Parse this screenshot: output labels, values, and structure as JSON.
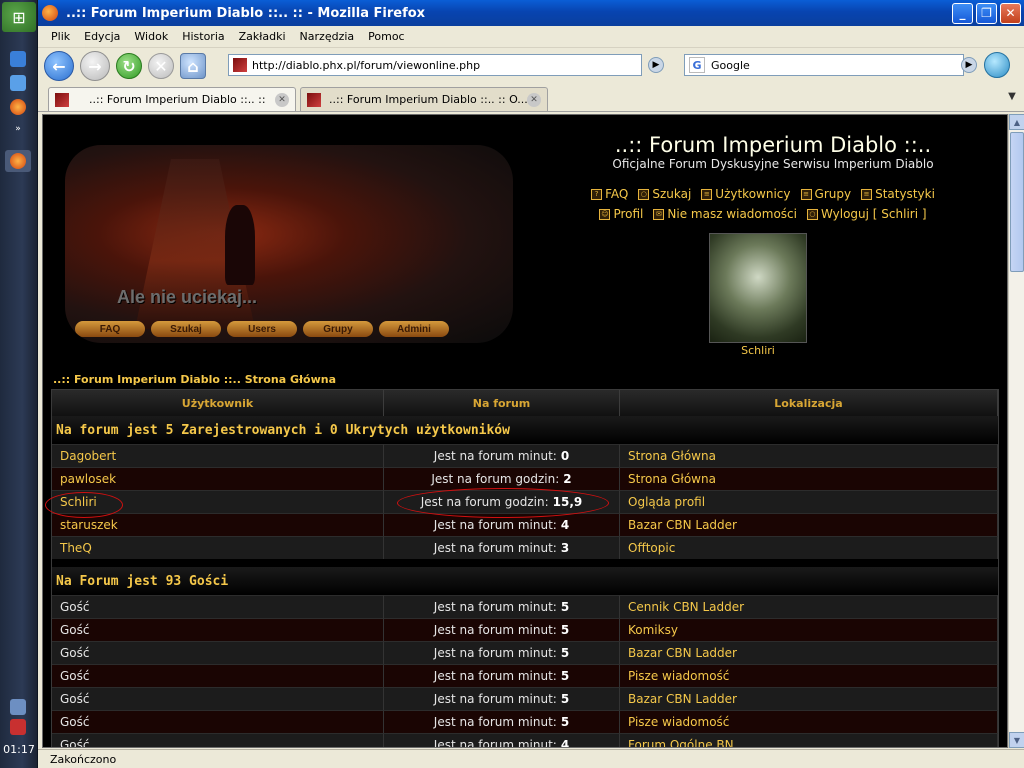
{
  "taskbar": {
    "clock": "01:17"
  },
  "window": {
    "title": "..:: Forum Imperium Diablo ::.. :: - Mozilla Firefox"
  },
  "menu": [
    "Plik",
    "Edycja",
    "Widok",
    "Historia",
    "Zakładki",
    "Narzędzia",
    "Pomoc"
  ],
  "nav": {
    "url": "http://diablo.phx.pl/forum/viewonline.php",
    "search_placeholder": "Google",
    "search_engine_icon": "google-icon"
  },
  "tabs": [
    {
      "label": "..:: Forum Imperium Diablo ::.. ::"
    },
    {
      "label": "..:: Forum Imperium Diablo ::.. :: O..."
    }
  ],
  "header": {
    "title": "..:: Forum Imperium Diablo ::..",
    "subtitle": "Oficjalne Forum Dyskusyjne Serwisu Imperium Diablo",
    "links_row1": [
      "FAQ",
      "Szukaj",
      "Użytkownicy",
      "Grupy",
      "Statystyki"
    ],
    "links_row2": [
      "Profil",
      "Nie masz wiadomości",
      "Wyloguj [ Schliri ]"
    ],
    "avatar_caption": "Schliri"
  },
  "banner": {
    "tagline": "Ale nie uciekaj...",
    "buttons": [
      "FAQ",
      "Szukaj",
      "Users",
      "Grupy",
      "Admini"
    ]
  },
  "breadcrumb": "..:: Forum Imperium Diablo ::.. Strona Główna",
  "table": {
    "headers": [
      "Użytkownik",
      "Na forum",
      "Lokalizacja"
    ],
    "registered_title": "Na forum jest 5 Zarejestrowanych i 0 Ukrytych użytkowników",
    "registered": [
      {
        "user": "Dagobert",
        "time_label": "Jest na forum minut:",
        "time_value": "0",
        "location": "Strona Główna"
      },
      {
        "user": "pawlosek",
        "time_label": "Jest na forum godzin:",
        "time_value": "2",
        "location": "Strona Główna"
      },
      {
        "user": "Schliri",
        "time_label": "Jest na forum godzin:",
        "time_value": "15,9",
        "location": "Ogląda profil"
      },
      {
        "user": "staruszek",
        "time_label": "Jest na forum minut:",
        "time_value": "4",
        "location": "Bazar CBN Ladder"
      },
      {
        "user": "TheQ",
        "time_label": "Jest na forum minut:",
        "time_value": "3",
        "location": "Offtopic"
      }
    ],
    "guests_title": "Na Forum jest 93 Gości",
    "guests": [
      {
        "user": "Gość",
        "time_label": "Jest na forum minut:",
        "time_value": "5",
        "location": "Cennik CBN Ladder"
      },
      {
        "user": "Gość",
        "time_label": "Jest na forum minut:",
        "time_value": "5",
        "location": "Komiksy"
      },
      {
        "user": "Gość",
        "time_label": "Jest na forum minut:",
        "time_value": "5",
        "location": "Bazar CBN Ladder"
      },
      {
        "user": "Gość",
        "time_label": "Jest na forum minut:",
        "time_value": "5",
        "location": "Pisze wiadomość"
      },
      {
        "user": "Gość",
        "time_label": "Jest na forum minut:",
        "time_value": "5",
        "location": "Bazar CBN Ladder"
      },
      {
        "user": "Gość",
        "time_label": "Jest na forum minut:",
        "time_value": "5",
        "location": "Pisze wiadomość"
      },
      {
        "user": "Gość",
        "time_label": "Jest na forum minut:",
        "time_value": "4",
        "location": "Forum Ogólne BN"
      }
    ]
  },
  "status": "Zakończono",
  "colors": {
    "accent": "#f5c84a",
    "titlebar": "#0a5ed6",
    "annotation": "#d01010"
  }
}
